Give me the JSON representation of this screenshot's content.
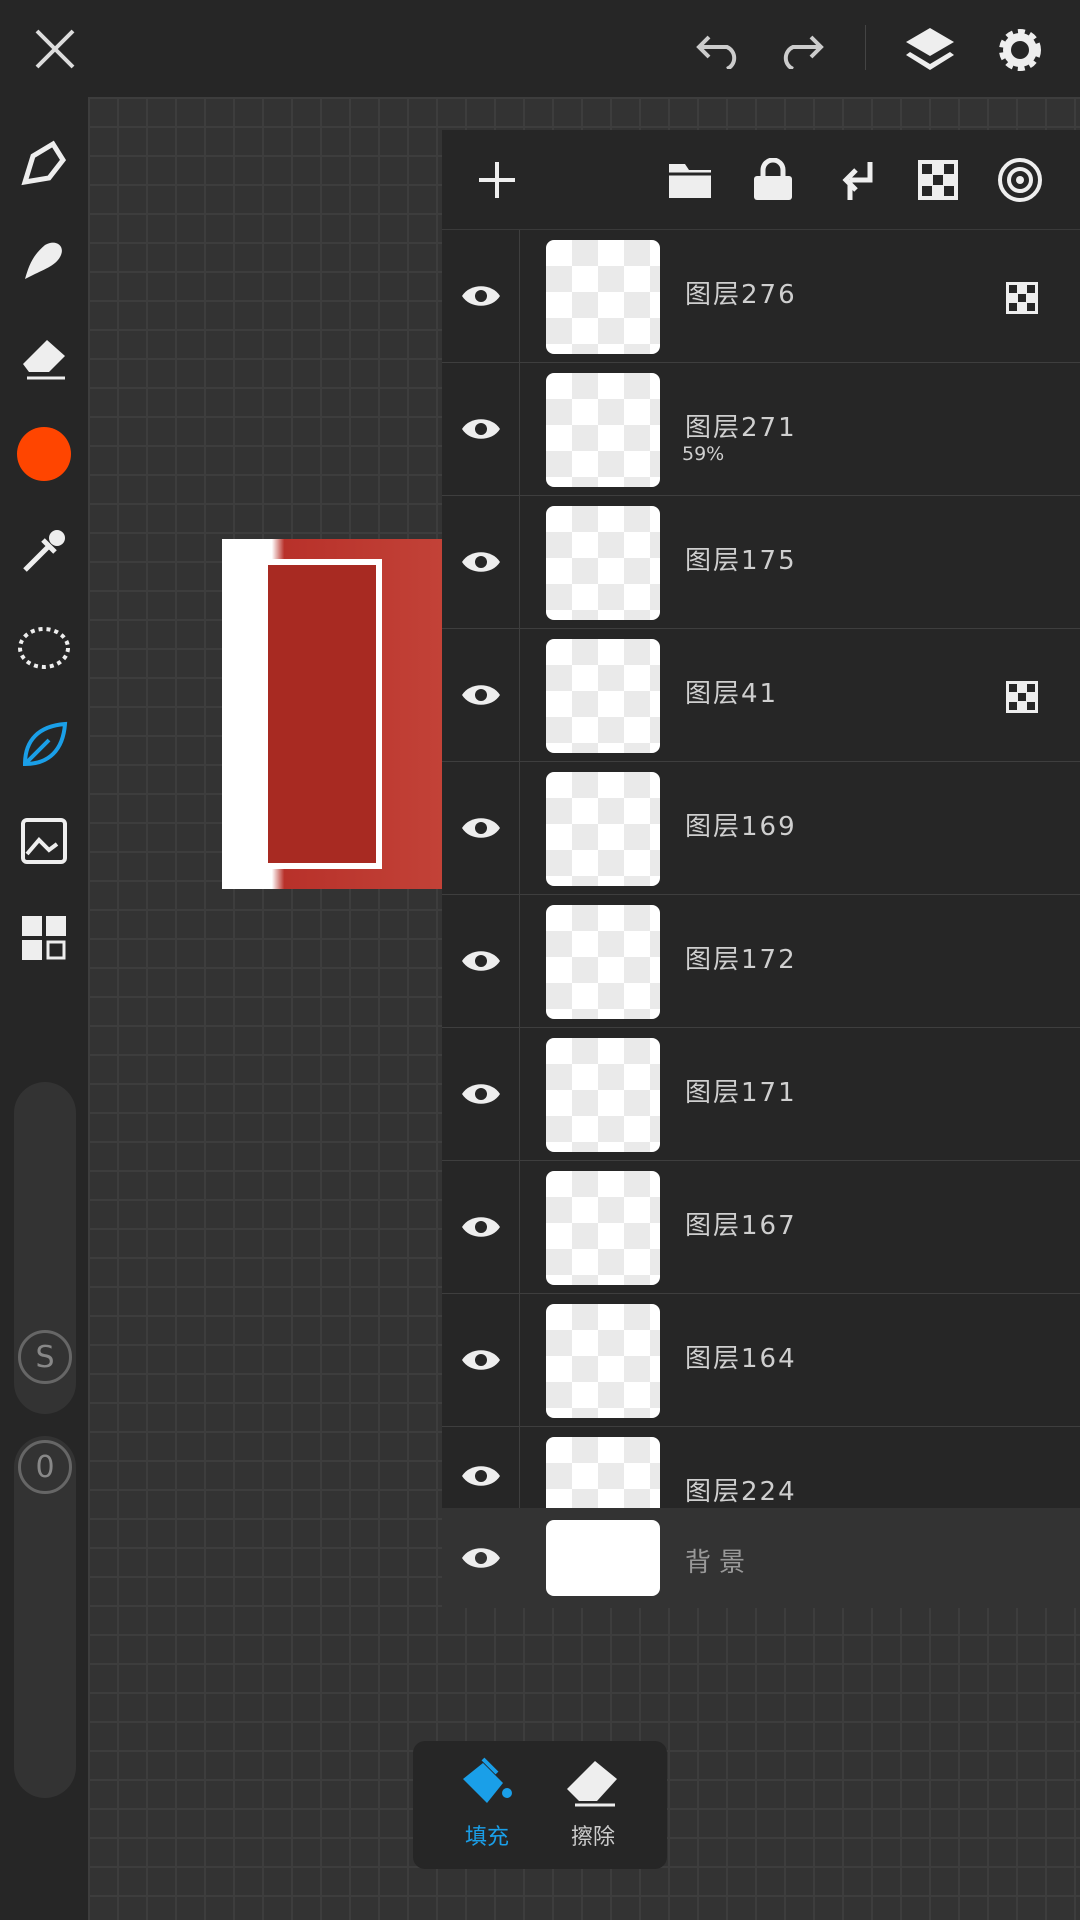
{
  "topbar": {
    "icons": [
      "close-icon",
      "undo-icon",
      "redo-icon",
      "layers-icon",
      "gear-icon"
    ]
  },
  "tools": [
    "pen-icon",
    "smudge-icon",
    "eraser-icon",
    "color-swatch",
    "eyedropper-icon",
    "lasso-icon",
    "leaf-brush-icon",
    "image-import-icon",
    "grid-icon"
  ],
  "colors": {
    "current": "#ff4500",
    "accent": "#1a9fe8"
  },
  "sliders": {
    "size_label": "S",
    "opacity_label": "0"
  },
  "layers_toolbar": {
    "icons": [
      "add-icon",
      "folder-icon",
      "lock-icon",
      "merge-down-icon",
      "alpha-lock-icon",
      "target-icon"
    ]
  },
  "layers": [
    {
      "name": "图层276",
      "alpha_lock": true
    },
    {
      "name": "图层271",
      "opacity": "59%"
    },
    {
      "name": "图层175"
    },
    {
      "name": "图层41",
      "alpha_lock": true
    },
    {
      "name": "图层169"
    },
    {
      "name": "图层172"
    },
    {
      "name": "图层171"
    },
    {
      "name": "图层167"
    },
    {
      "name": "图层164"
    },
    {
      "name": "图层224"
    }
  ],
  "background_layer": {
    "name": "背景"
  },
  "fill_panel": {
    "fill_label": "填充",
    "erase_label": "擦除"
  }
}
